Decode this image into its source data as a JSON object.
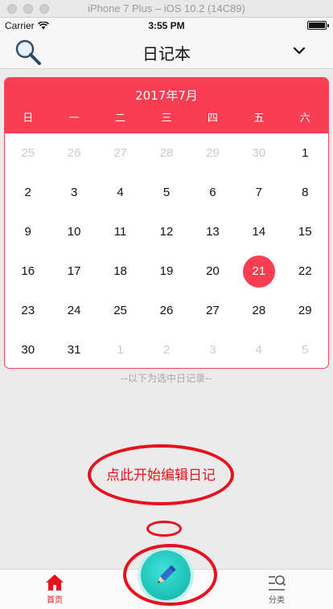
{
  "simulator": {
    "title": "iPhone 7 Plus – iOS 10.2 (14C89)"
  },
  "status_bar": {
    "carrier": "Carrier",
    "time": "3:55 PM",
    "battery_level": 1.0
  },
  "nav": {
    "title": "日记本",
    "search_icon": "search-icon",
    "chevron_icon": "chevron-down-icon"
  },
  "calendar": {
    "month_label": "2017年7月",
    "weekdays": [
      "日",
      "一",
      "二",
      "三",
      "四",
      "五",
      "六"
    ],
    "days": [
      {
        "d": "25",
        "other": true
      },
      {
        "d": "26",
        "other": true
      },
      {
        "d": "27",
        "other": true
      },
      {
        "d": "28",
        "other": true
      },
      {
        "d": "29",
        "other": true
      },
      {
        "d": "30",
        "other": true
      },
      {
        "d": "1"
      },
      {
        "d": "2"
      },
      {
        "d": "3"
      },
      {
        "d": "4"
      },
      {
        "d": "5"
      },
      {
        "d": "6"
      },
      {
        "d": "7"
      },
      {
        "d": "8"
      },
      {
        "d": "9"
      },
      {
        "d": "10"
      },
      {
        "d": "11"
      },
      {
        "d": "12"
      },
      {
        "d": "13"
      },
      {
        "d": "14"
      },
      {
        "d": "15"
      },
      {
        "d": "16"
      },
      {
        "d": "17"
      },
      {
        "d": "18"
      },
      {
        "d": "19"
      },
      {
        "d": "20"
      },
      {
        "d": "21",
        "selected": true
      },
      {
        "d": "22"
      },
      {
        "d": "23"
      },
      {
        "d": "24"
      },
      {
        "d": "25"
      },
      {
        "d": "26"
      },
      {
        "d": "27"
      },
      {
        "d": "28"
      },
      {
        "d": "29"
      },
      {
        "d": "30"
      },
      {
        "d": "31"
      },
      {
        "d": "1",
        "other": true
      },
      {
        "d": "2",
        "other": true
      },
      {
        "d": "3",
        "other": true
      },
      {
        "d": "4",
        "other": true
      },
      {
        "d": "5",
        "other": true
      }
    ],
    "accent_color": "#f83e52"
  },
  "hint": "--以下为选中日记录--",
  "annotation": {
    "text": "点此开始编辑日记",
    "color": "#e8101a"
  },
  "tabbar": {
    "home_label": "首页",
    "category_label": "分类",
    "fab_icon": "pencil-icon"
  }
}
